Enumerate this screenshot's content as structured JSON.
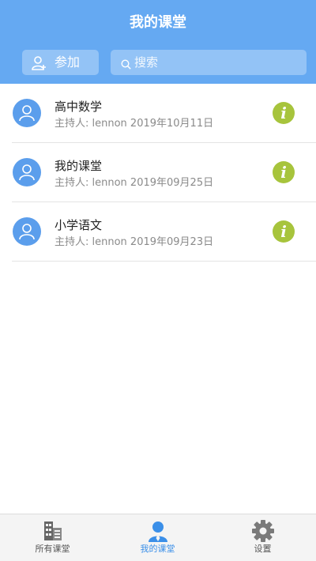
{
  "header": {
    "title": "我的课堂",
    "join_label": "参加",
    "search_placeholder": "搜索"
  },
  "classrooms": [
    {
      "title": "高中数学",
      "host": "主持人:  lennon  2019年10月11日"
    },
    {
      "title": "我的课堂",
      "host": "主持人:  lennon  2019年09月25日"
    },
    {
      "title": "小学语文",
      "host": "主持人:  lennon  2019年09月23日"
    }
  ],
  "info_glyph": "i",
  "tabbar": {
    "tabs": [
      {
        "label": "所有课堂",
        "icon": "building-icon"
      },
      {
        "label": "我的课堂",
        "icon": "user-icon",
        "active": true
      },
      {
        "label": "设置",
        "icon": "gear-icon"
      }
    ]
  },
  "colors": {
    "header": "#65a9f2",
    "avatar": "#5b9eec",
    "info": "#a7c43c",
    "active_tab": "#3b8fe8"
  }
}
